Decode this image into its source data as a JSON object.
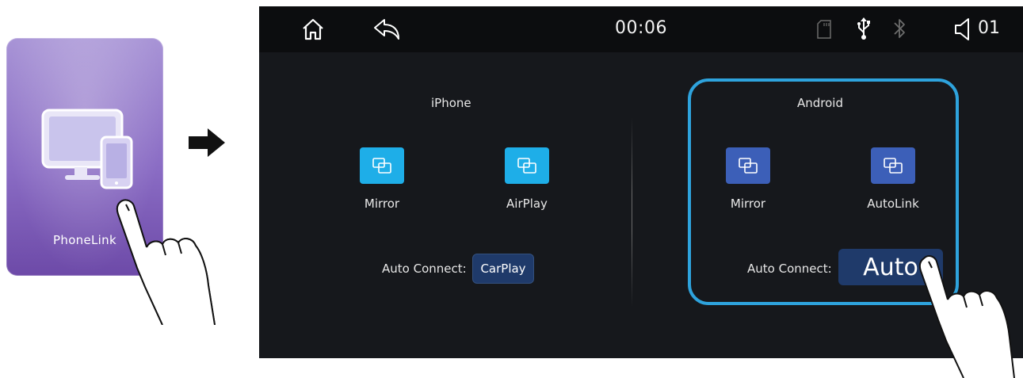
{
  "tile": {
    "label": "PhoneLink",
    "icon": "monitor-phone-icon",
    "gradient_top": "#a894d6",
    "gradient_bottom": "#6d4aa8"
  },
  "statusbar": {
    "time": "00:06",
    "volume": "01",
    "icons": [
      "home-icon",
      "back-icon",
      "sd-card-icon",
      "usb-icon",
      "bluetooth-icon",
      "volume-icon"
    ]
  },
  "iphone": {
    "title": "iPhone",
    "apps": [
      {
        "label": "Mirror",
        "icon": "screen-mirror-icon"
      },
      {
        "label": "AirPlay",
        "icon": "screen-mirror-icon"
      }
    ],
    "auto_connect_label": "Auto Connect:",
    "auto_connect_value": "CarPlay",
    "button_color": "#1eaee8"
  },
  "android": {
    "title": "Android",
    "apps": [
      {
        "label": "Mirror",
        "icon": "screen-mirror-icon"
      },
      {
        "label": "AutoLink",
        "icon": "screen-mirror-icon"
      }
    ],
    "auto_connect_label": "Auto Connect:",
    "auto_connect_value": "Auto",
    "button_color": "#3c5fb8",
    "highlight_color": "#2ea3dd"
  }
}
